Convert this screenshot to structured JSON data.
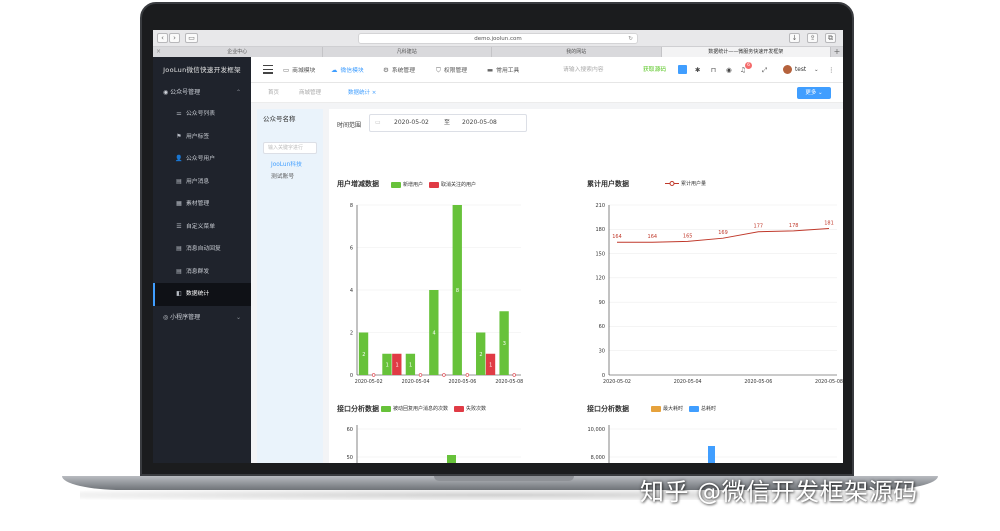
{
  "browser": {
    "url": "demo.joolun.com",
    "tabs": [
      "企业中心",
      "凡科建站",
      "我的网站",
      "数据统计——微服务快速开发框架"
    ]
  },
  "sidebar": {
    "brand": "JooLun微信快速开发框架",
    "group": "公众号管理",
    "items": [
      {
        "label": "公众号列表",
        "icon": "sliders-icon",
        "glyph": "⚌"
      },
      {
        "label": "用户标签",
        "icon": "flag-icon",
        "glyph": "⚑"
      },
      {
        "label": "公众号用户",
        "icon": "user-icon",
        "glyph": "👤"
      },
      {
        "label": "用户消息",
        "icon": "message-icon",
        "glyph": "▤"
      },
      {
        "label": "素材管理",
        "icon": "folder-icon",
        "glyph": "▦"
      },
      {
        "label": "自定义菜单",
        "icon": "menu-icon",
        "glyph": "☰"
      },
      {
        "label": "消息自动回复",
        "icon": "reply-icon",
        "glyph": "▤"
      },
      {
        "label": "消息群发",
        "icon": "broadcast-icon",
        "glyph": "▤"
      },
      {
        "label": "数据统计",
        "icon": "stats-icon",
        "glyph": "◧"
      }
    ],
    "group2": "小程序管理"
  },
  "header": {
    "nav": [
      {
        "label": "商城模块",
        "icon": "shop-icon",
        "glyph": "▭"
      },
      {
        "label": "微信模块",
        "icon": "wechat-icon",
        "glyph": "☁"
      },
      {
        "label": "系统管理",
        "icon": "gear-icon",
        "glyph": "⚙"
      },
      {
        "label": "权限管理",
        "icon": "shield-icon",
        "glyph": "⛉"
      },
      {
        "label": "常用工具",
        "icon": "toolbox-icon",
        "glyph": "▬"
      }
    ],
    "search_placeholder": "请输入搜索内容",
    "source_code": "获取源码",
    "badge_count": "6",
    "username": "test"
  },
  "tags": {
    "home": "首页",
    "mall": "商城管理",
    "current": "数据统计 ×",
    "more": "更多 ⌄"
  },
  "left_panel": {
    "title": "公众号名称",
    "search_placeholder": "输入关键字进行",
    "accounts": [
      "JooLun科技",
      "测试账号"
    ]
  },
  "filter": {
    "label": "时间范围",
    "start": "2020-05-02",
    "separator": "至",
    "end": "2020-05-08"
  },
  "chart_data": [
    {
      "type": "bar",
      "title": "用户增减数据",
      "categories": [
        "2020-05-02",
        "2020-05-03",
        "2020-05-04",
        "2020-05-05",
        "2020-05-06",
        "2020-05-07",
        "2020-05-08"
      ],
      "x_tick_labels": [
        "2020-05-02",
        "2020-05-04",
        "2020-05-06",
        "2020-05-08"
      ],
      "series": [
        {
          "name": "新增用户",
          "color": "#67c23a",
          "values": [
            2,
            1,
            1,
            4,
            8,
            2,
            3
          ]
        },
        {
          "name": "取消关注的用户",
          "color": "#e03b45",
          "values": [
            0,
            1,
            0,
            0,
            0,
            1,
            0
          ]
        }
      ],
      "ylim": [
        0,
        8
      ],
      "yticks": [
        0,
        2,
        4,
        6,
        8
      ]
    },
    {
      "type": "line",
      "title": "累计用户数据",
      "x": [
        "2020-05-02",
        "2020-05-03",
        "2020-05-04",
        "2020-05-05",
        "2020-05-06",
        "2020-05-07",
        "2020-05-08"
      ],
      "x_tick_labels": [
        "2020-05-02",
        "2020-05-04",
        "2020-05-06",
        "2020-05-08"
      ],
      "series": [
        {
          "name": "累计用户量",
          "color": "#c0392b",
          "values": [
            164,
            164,
            165,
            169,
            177,
            178,
            181
          ]
        }
      ],
      "ylim": [
        0,
        210
      ],
      "yticks": [
        0,
        30,
        60,
        90,
        120,
        150,
        180,
        210
      ]
    },
    {
      "type": "bar",
      "title": "接口分析数据",
      "series": [
        {
          "name": "被动回复用户消息的次数",
          "color": "#67c23a"
        },
        {
          "name": "失败次数",
          "color": "#e03b45"
        }
      ],
      "yticks_visible": [
        40,
        50,
        60
      ]
    },
    {
      "type": "bar",
      "title": "接口分析数据",
      "series": [
        {
          "name": "最大耗时",
          "color": "#e6a23c"
        },
        {
          "name": "总耗时",
          "color": "#409eff"
        }
      ],
      "yticks_visible": [
        8000,
        10000
      ],
      "ytick_labels_visible": [
        "8,000",
        "10,000"
      ]
    }
  ],
  "watermark": "知乎 @微信开发框架源码"
}
